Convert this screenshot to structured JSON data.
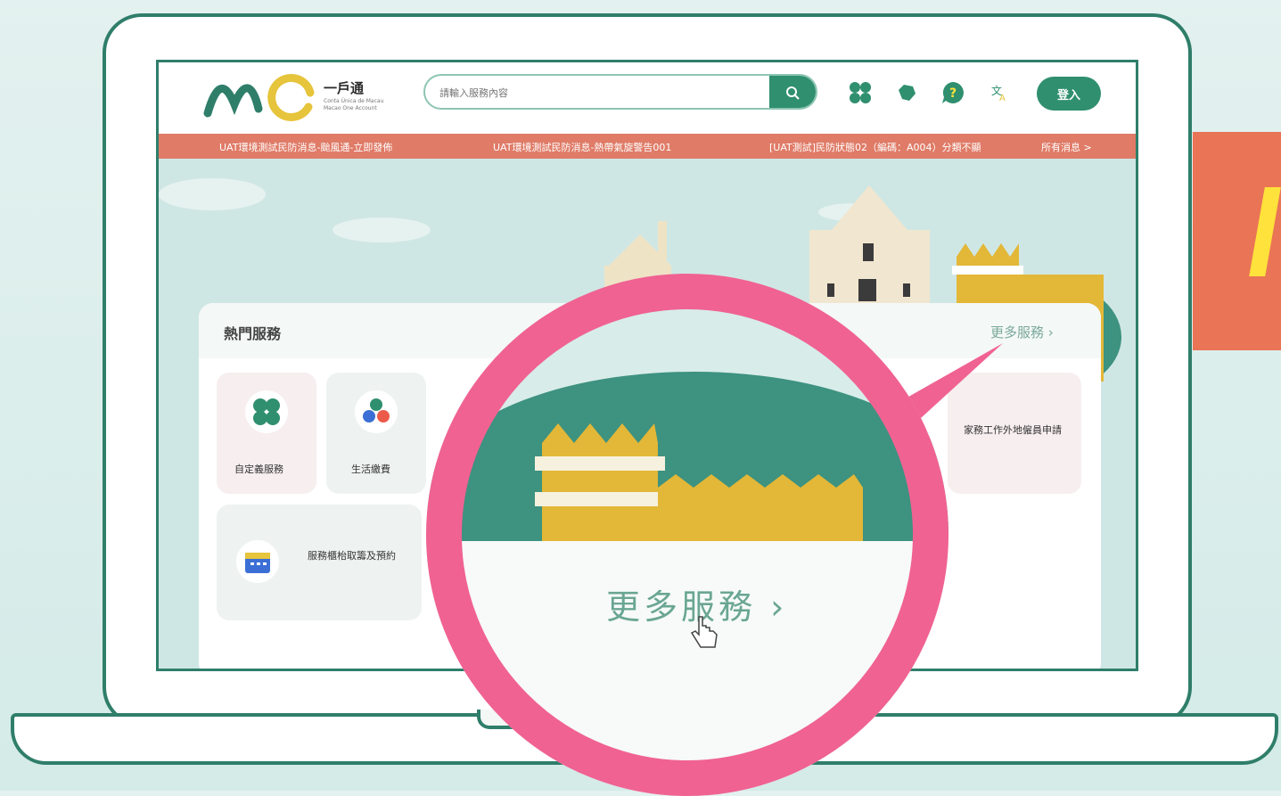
{
  "header": {
    "brand_name": "一戶通",
    "brand_sub_1": "Conta Única de Macau",
    "brand_sub_2": "Macao One Account",
    "search_placeholder": "請輸入服務內容",
    "login_label": "登入"
  },
  "ticker": {
    "items": [
      "UAT環境測試民防消息-颱風通-立即發佈",
      "UAT環境測試民防消息-熱帶氣旋警告001",
      "[UAT測試]民防狀態02（編碼：A004）分類不顯"
    ],
    "all_news": "所有消息 >"
  },
  "hot_services": {
    "title": "熱門服務",
    "more_label": "更多服務",
    "tiles": [
      {
        "label": "自定義服務",
        "icon": "grid-icon"
      },
      {
        "label": "生活繳費",
        "icon": "utility-drops-icon"
      },
      {
        "label": "服務櫃枱取籌及預約",
        "icon": "calendar-icon"
      },
      {
        "label": "家務工作外地僱員申請",
        "icon": "worker-icon"
      }
    ]
  },
  "magnifier": {
    "more_label": "更多服務"
  },
  "colors": {
    "brand_green": "#2f8f6e",
    "ticker": "#df7b67",
    "magnifier_ring": "#f06292",
    "outline": "#2f7e6a"
  }
}
